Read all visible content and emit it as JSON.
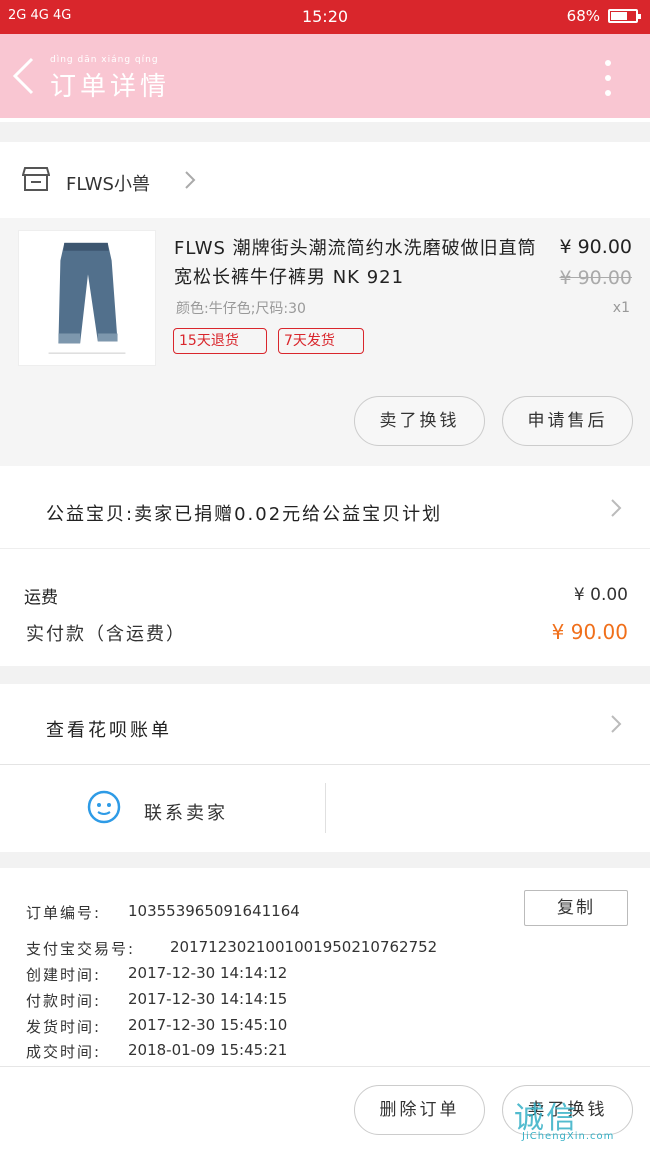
{
  "status_bar": {
    "signal": "2G 4G 4G",
    "time": "15:20",
    "battery": "68%",
    "battery_level": 0.68
  },
  "header": {
    "title": "订单详情",
    "title_pinyin": "dìng  dān  xiáng  qíng"
  },
  "shop": {
    "name": "FLWS小兽"
  },
  "product": {
    "title": "FLWS 潮牌街头潮流简约水洗磨破做旧直筒宽松长裤牛仔裤男 NK 921",
    "sku": "颜色:牛仔色;尺码:30",
    "price": "¥ 90.00",
    "original_price": "¥ 90.00",
    "quantity": "x1",
    "tags": [
      "15天退货",
      "7天发货"
    ],
    "actions": [
      "卖了换钱",
      "申请售后"
    ]
  },
  "charity": {
    "text": "公益宝贝:卖家已捐赠0.02元给公益宝贝计划"
  },
  "totals": {
    "shipping_label": "运费",
    "shipping_value": "¥ 0.00",
    "paid_label": "实付款（含运费）",
    "paid_value": "¥ 90.00"
  },
  "huabei": {
    "text": "查看花呗账单"
  },
  "contact": {
    "label": "联系卖家"
  },
  "order_info": {
    "copy_label": "复制",
    "rows": [
      {
        "key": "订单编号:",
        "value": "103553965091641164"
      },
      {
        "key": "支付宝交易号:",
        "value": "2017123021001001950210762752"
      },
      {
        "key": "创建时间:",
        "value": "2017-12-30 14:14:12"
      },
      {
        "key": "付款时间:",
        "value": "2017-12-30 14:14:15"
      },
      {
        "key": "发货时间:",
        "value": "2017-12-30 15:45:10"
      },
      {
        "key": "成交时间:",
        "value": "2018-01-09 15:45:21"
      }
    ]
  },
  "bottom_bar": {
    "delete_label": "删除订单",
    "sell_label": "卖了换钱"
  },
  "watermark": {
    "logo": "诚信",
    "url": "JiChengXin.com"
  },
  "colors": {
    "status_bar": "#d9262c",
    "header": "#f9c6d2",
    "tag": "#d9262c",
    "paid_amount": "#f06f1a",
    "chat_icon": "#2e9be6"
  }
}
